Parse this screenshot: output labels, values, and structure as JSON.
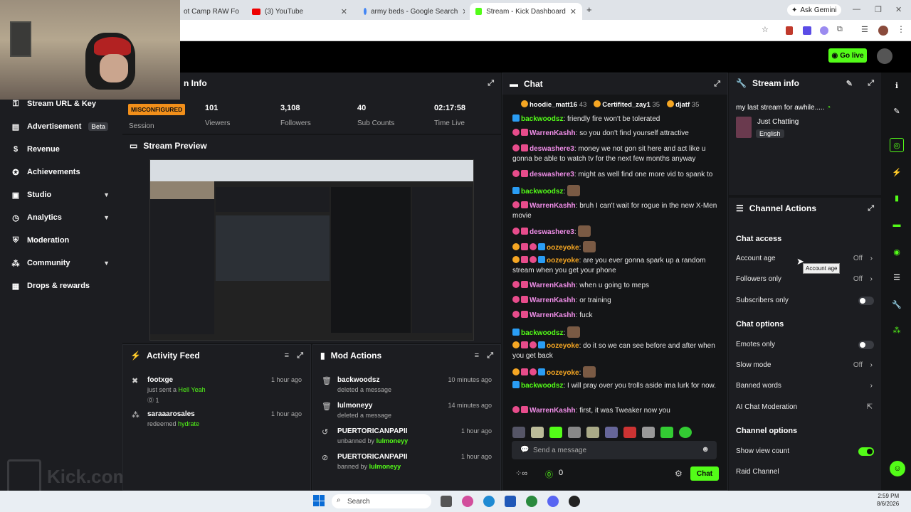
{
  "browser": {
    "tabs": [
      {
        "label": "ot Camp RAW Fo",
        "active": false
      },
      {
        "label": "(3) YouTube",
        "active": false
      },
      {
        "label": "army beds - Google Search",
        "active": false
      },
      {
        "label": "Stream - Kick Dashboard",
        "active": true
      }
    ],
    "ask_gemini": "Ask Gemini",
    "new_tab": "+"
  },
  "topbar": {
    "go_live": "Go live"
  },
  "sidebar": {
    "items": [
      {
        "label": "Stream URL & Key",
        "icon": "key-icon",
        "badge": "",
        "chevron": false
      },
      {
        "label": "Advertisement",
        "icon": "ad-icon",
        "badge": "Beta",
        "chevron": false
      },
      {
        "label": "Revenue",
        "icon": "dollar-icon",
        "badge": "",
        "chevron": false
      },
      {
        "label": "Achievements",
        "icon": "achievement-icon",
        "badge": "",
        "chevron": false
      },
      {
        "label": "Studio",
        "icon": "studio-icon",
        "badge": "",
        "chevron": true
      },
      {
        "label": "Analytics",
        "icon": "analytics-icon",
        "badge": "",
        "chevron": true
      },
      {
        "label": "Moderation",
        "icon": "shield-icon",
        "badge": "",
        "chevron": false
      },
      {
        "label": "Community",
        "icon": "community-icon",
        "badge": "",
        "chevron": true
      },
      {
        "label": "Drops & rewards",
        "icon": "gift-icon",
        "badge": "",
        "chevron": false
      }
    ],
    "watermark": "Kick.com/lulmoneyy"
  },
  "stream_info": {
    "title": "n Info",
    "status": "MISCONFIGURED",
    "session_label": "Session",
    "stats": [
      {
        "value": "101",
        "label": "Viewers"
      },
      {
        "value": "3,108",
        "label": "Followers"
      },
      {
        "value": "40",
        "label": "Sub Counts"
      },
      {
        "value": "02:17:58",
        "label": "Time Live"
      }
    ]
  },
  "preview": {
    "title": "Stream Preview"
  },
  "activity": {
    "title": "Activity Feed",
    "items": [
      {
        "name": "footxge",
        "text": "just sent a",
        "highlight": "Hell Yeah",
        "extra": "1",
        "time": "1 hour ago"
      },
      {
        "name": "saraaarosales",
        "text": "redeemed",
        "highlight": "hydrate",
        "extra": "",
        "time": "1 hour ago"
      }
    ]
  },
  "mod_actions": {
    "title": "Mod Actions",
    "items": [
      {
        "name": "backwoodsz",
        "text": "deleted a message",
        "by": "",
        "time": "10 minutes ago",
        "icon": "trash-icon"
      },
      {
        "name": "lulmoneyy",
        "text": "deleted a message",
        "by": "",
        "time": "14 minutes ago",
        "icon": "trash-icon"
      },
      {
        "name": "PUERTORICANPAPII",
        "text": "unbanned by",
        "by": "lulmoneyy",
        "time": "1 hour ago",
        "icon": "unban-icon"
      },
      {
        "name": "PUERTORICANPAPII",
        "text": "banned by",
        "by": "lulmoneyy",
        "time": "1 hour ago",
        "icon": "ban-icon"
      }
    ]
  },
  "chat": {
    "title": "Chat",
    "top_gifters": [
      {
        "name": "hoodie_matt16",
        "count": "43"
      },
      {
        "name": "Certifited_zay1",
        "count": "35"
      },
      {
        "name": "djatf",
        "count": "35"
      }
    ],
    "messages": [
      {
        "user": "backwoodsz",
        "color": "#53fc18",
        "badges": [
          "mod"
        ],
        "text": ": friendly fire won't be tolerated",
        "emote": false
      },
      {
        "user": "WarrenKashh",
        "color": "#f08ee8",
        "badges": [
          "vip",
          "gift"
        ],
        "text": ": so you don't find yourself attractive",
        "emote": false
      },
      {
        "user": "deswashere3",
        "color": "#f08ee8",
        "badges": [
          "vip",
          "gift"
        ],
        "text": ": money we not gon sit here and act like u gonna be able to watch tv for the next few months anyway",
        "emote": false
      },
      {
        "user": "deswashere3",
        "color": "#f08ee8",
        "badges": [
          "vip",
          "gift"
        ],
        "text": ": might as well find one more vid to spank to",
        "emote": false
      },
      {
        "user": "backwoodsz",
        "color": "#53fc18",
        "badges": [
          "mod"
        ],
        "text": ":",
        "emote": true
      },
      {
        "user": "WarrenKashh",
        "color": "#f08ee8",
        "badges": [
          "vip",
          "gift"
        ],
        "text": ": bruh I can't wait for rogue in the new X-Men movie",
        "emote": false
      },
      {
        "user": "deswashere3",
        "color": "#f08ee8",
        "badges": [
          "vip",
          "gift"
        ],
        "text": ":",
        "emote": true
      },
      {
        "user": "oozeyoke",
        "color": "#f5a623",
        "badges": [
          "sub",
          "gift",
          "vip",
          "mod"
        ],
        "text": ":",
        "emote": true
      },
      {
        "user": "oozeyoke",
        "color": "#f5a623",
        "badges": [
          "sub",
          "gift",
          "vip",
          "mod"
        ],
        "text": ": are you ever gonna spark up a random stream when you get your phone",
        "emote": false
      },
      {
        "user": "WarrenKashh",
        "color": "#f08ee8",
        "badges": [
          "vip",
          "gift"
        ],
        "text": ": when u going to meps",
        "emote": false
      },
      {
        "user": "WarrenKashh",
        "color": "#f08ee8",
        "badges": [
          "vip",
          "gift"
        ],
        "text": ": or training",
        "emote": false
      },
      {
        "user": "WarrenKashh",
        "color": "#f08ee8",
        "badges": [
          "vip",
          "gift"
        ],
        "text": ": fuck",
        "emote": false
      },
      {
        "user": "backwoodsz",
        "color": "#53fc18",
        "badges": [
          "mod"
        ],
        "text": ":",
        "emote": true
      },
      {
        "user": "oozeyoke",
        "color": "#f5a623",
        "badges": [
          "sub",
          "gift",
          "vip",
          "mod"
        ],
        "text": ": do it so we can see before and after when you get back",
        "emote": false
      },
      {
        "user": "oozeyoke",
        "color": "#f5a623",
        "badges": [
          "sub",
          "gift",
          "vip",
          "mod"
        ],
        "text": ":",
        "emote": true
      },
      {
        "user": "backwoodsz",
        "color": "#53fc18",
        "badges": [
          "mod"
        ],
        "text": ": I will pray over you trolls aside ima lurk for now.",
        "emote": false
      },
      {
        "user": "WarrenKashh",
        "color": "#f08ee8",
        "badges": [
          "vip",
          "gift"
        ],
        "text": ": first, it was Tweaker now you",
        "emote": false
      }
    ],
    "input_placeholder": "Send a message",
    "points": "0",
    "send_label": "Chat"
  },
  "stream_info_panel": {
    "title": "Stream info",
    "stream_title": "my last stream for awhile.....",
    "category": "Just Chatting",
    "language": "English"
  },
  "channel_actions": {
    "title": "Channel Actions",
    "sections": [
      {
        "title": "Chat access",
        "rows": [
          {
            "label": "Account age",
            "value": "Off",
            "kind": "chevron"
          },
          {
            "label": "Followers only",
            "value": "Off",
            "kind": "chevron"
          },
          {
            "label": "Subscribers only",
            "value": "",
            "kind": "toggle-off"
          }
        ]
      },
      {
        "title": "Chat options",
        "rows": [
          {
            "label": "Emotes only",
            "value": "",
            "kind": "toggle-off"
          },
          {
            "label": "Slow mode",
            "value": "Off",
            "kind": "chevron"
          },
          {
            "label": "Banned words",
            "value": "",
            "kind": "chevron"
          },
          {
            "label": "AI Chat Moderation",
            "value": "",
            "kind": "link"
          }
        ]
      },
      {
        "title": "Channel options",
        "rows": [
          {
            "label": "Show view count",
            "value": "",
            "kind": "toggle-on"
          },
          {
            "label": "Raid Channel",
            "value": "",
            "kind": "none"
          }
        ]
      }
    ],
    "tooltip": "Account age"
  },
  "taskbar": {
    "search_placeholder": "Search",
    "time": "2:59 PM",
    "date": "8/6/2026"
  },
  "colors": {
    "accent": "#53fc18",
    "warning": "#f28f1a",
    "bg": "#141517",
    "panel": "#1c1d21"
  }
}
